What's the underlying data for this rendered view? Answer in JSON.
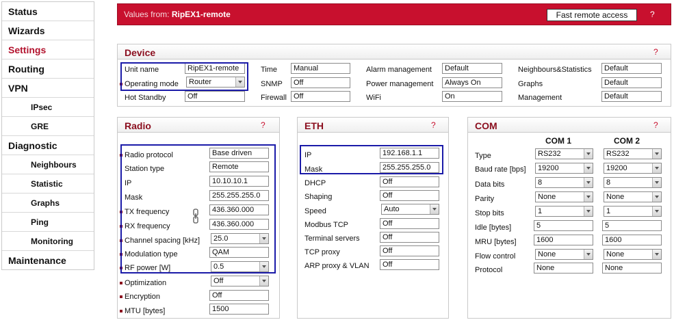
{
  "sidebar": {
    "items": [
      {
        "label": "Status",
        "level": "top",
        "active": false
      },
      {
        "label": "Wizards",
        "level": "top",
        "active": false
      },
      {
        "label": "Settings",
        "level": "top",
        "active": true
      },
      {
        "label": "Routing",
        "level": "top",
        "active": false
      },
      {
        "label": "VPN",
        "level": "top",
        "active": false
      },
      {
        "label": "IPsec",
        "level": "sub",
        "active": false
      },
      {
        "label": "GRE",
        "level": "sub",
        "active": false
      },
      {
        "label": "Diagnostic",
        "level": "top",
        "active": false
      },
      {
        "label": "Neighbours",
        "level": "sub",
        "active": false
      },
      {
        "label": "Statistic",
        "level": "sub",
        "active": false
      },
      {
        "label": "Graphs",
        "level": "sub",
        "active": false
      },
      {
        "label": "Ping",
        "level": "sub",
        "active": false
      },
      {
        "label": "Monitoring",
        "level": "sub",
        "active": false
      },
      {
        "label": "Maintenance",
        "level": "top",
        "active": false
      }
    ]
  },
  "header": {
    "prefix": "Values from:",
    "station": "RipEX1-remote",
    "fast_remote_label": "Fast remote access",
    "help": "?"
  },
  "device": {
    "title": "Device",
    "help": "?",
    "unit_name": {
      "label": "Unit name",
      "value": "RipEX1-remote"
    },
    "operating_mode": {
      "label": "Operating mode",
      "value": "Router"
    },
    "hot_standby": {
      "label": "Hot Standby",
      "value": "Off"
    },
    "time": {
      "label": "Time",
      "value": "Manual"
    },
    "snmp": {
      "label": "SNMP",
      "value": "Off"
    },
    "firewall": {
      "label": "Firewall",
      "value": "Off"
    },
    "alarm_management": {
      "label": "Alarm management",
      "value": "Default"
    },
    "power_management": {
      "label": "Power management",
      "value": "Always On"
    },
    "wifi": {
      "label": "WiFi",
      "value": "On"
    },
    "neighbours_statistics": {
      "label": "Neighbours&Statistics",
      "value": "Default"
    },
    "graphs": {
      "label": "Graphs",
      "value": "Default"
    },
    "management": {
      "label": "Management",
      "value": "Default"
    }
  },
  "radio": {
    "title": "Radio",
    "help": "?",
    "radio_protocol": {
      "label": "Radio protocol",
      "value": "Base driven"
    },
    "station_type": {
      "label": "Station type",
      "value": "Remote"
    },
    "ip": {
      "label": "IP",
      "value": "10.10.10.1"
    },
    "mask": {
      "label": "Mask",
      "value": "255.255.255.0"
    },
    "tx_frequency": {
      "label": "TX frequency",
      "value": "436.360.000"
    },
    "rx_frequency": {
      "label": "RX frequency",
      "value": "436.360.000"
    },
    "channel_spacing": {
      "label": "Channel spacing [kHz]",
      "value": "25.0"
    },
    "modulation_type": {
      "label": "Modulation type",
      "value": "QAM"
    },
    "rf_power": {
      "label": "RF power [W]",
      "value": "0.5"
    },
    "optimization": {
      "label": "Optimization",
      "value": "Off"
    },
    "encryption": {
      "label": "Encryption",
      "value": "Off"
    },
    "mtu": {
      "label": "MTU [bytes]",
      "value": "1500"
    }
  },
  "eth": {
    "title": "ETH",
    "help": "?",
    "ip": {
      "label": "IP",
      "value": "192.168.1.1"
    },
    "mask": {
      "label": "Mask",
      "value": "255.255.255.0"
    },
    "dhcp": {
      "label": "DHCP",
      "value": "Off"
    },
    "shaping": {
      "label": "Shaping",
      "value": "Off"
    },
    "speed": {
      "label": "Speed",
      "value": "Auto"
    },
    "modbus_tcp": {
      "label": "Modbus TCP",
      "value": "Off"
    },
    "terminal_servers": {
      "label": "Terminal servers",
      "value": "Off"
    },
    "tcp_proxy": {
      "label": "TCP proxy",
      "value": "Off"
    },
    "arp_proxy_vlan": {
      "label": "ARP proxy & VLAN",
      "value": "Off"
    }
  },
  "com": {
    "title": "COM",
    "help": "?",
    "col1": "COM 1",
    "col2": "COM 2",
    "type": {
      "label": "Type",
      "com1": "RS232",
      "com2": "RS232"
    },
    "baud_rate": {
      "label": "Baud rate [bps]",
      "com1": "19200",
      "com2": "19200"
    },
    "data_bits": {
      "label": "Data bits",
      "com1": "8",
      "com2": "8"
    },
    "parity": {
      "label": "Parity",
      "com1": "None",
      "com2": "None"
    },
    "stop_bits": {
      "label": "Stop bits",
      "com1": "1",
      "com2": "1"
    },
    "idle": {
      "label": "Idle [bytes]",
      "com1": "5",
      "com2": "5"
    },
    "mru": {
      "label": "MRU [bytes]",
      "com1": "1600",
      "com2": "1600"
    },
    "flow_control": {
      "label": "Flow control",
      "com1": "None",
      "com2": "None"
    },
    "protocol": {
      "label": "Protocol",
      "com1": "None",
      "com2": "None"
    }
  },
  "colors": {
    "brand": "#c8102e",
    "title": "#8b0e1e",
    "highlight": "#1a1aa8"
  }
}
